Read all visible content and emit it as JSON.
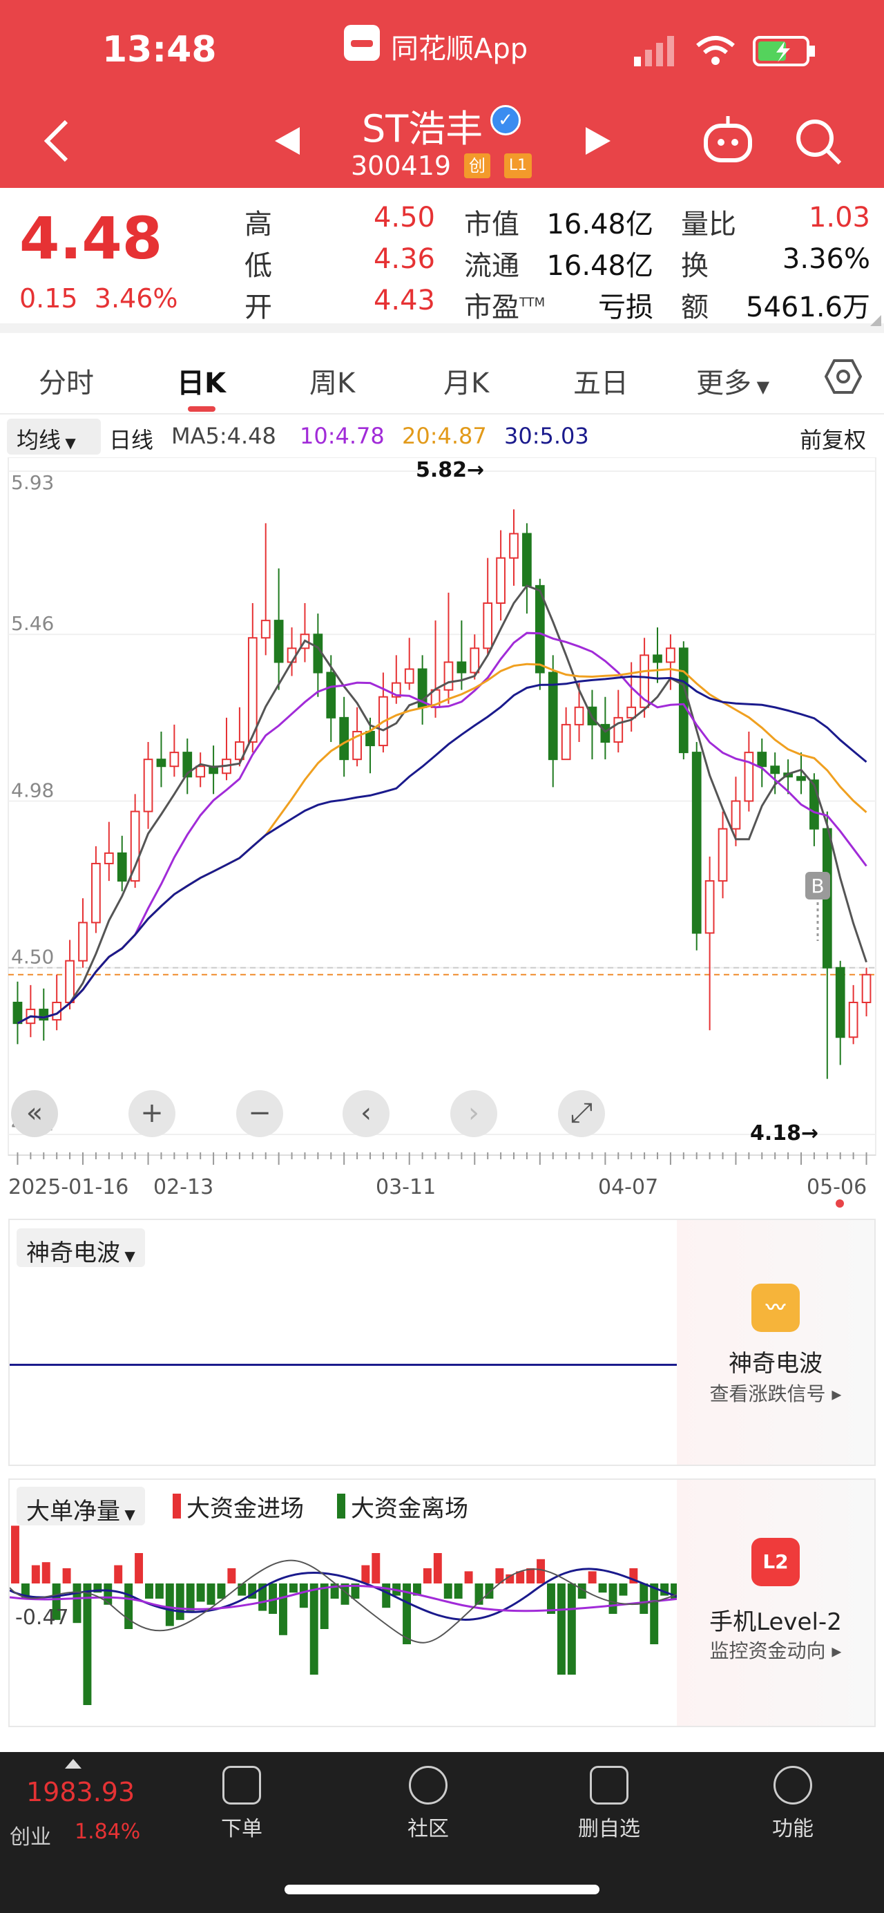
{
  "status_bar": {
    "time": "13:48",
    "app_name": "同花顺App"
  },
  "header": {
    "title": "ST浩丰",
    "code": "300419",
    "tag_chuang": "创",
    "tag_level": "L1"
  },
  "quote": {
    "price": "4.48",
    "change": "0.15",
    "change_pct": "3.46%",
    "fields": [
      {
        "label": "高",
        "value": "4.50",
        "color": "red"
      },
      {
        "label": "低",
        "value": "4.36",
        "color": "red"
      },
      {
        "label": "开",
        "value": "4.43",
        "color": "red"
      },
      {
        "label": "市值",
        "value": "16.48亿",
        "color": "black"
      },
      {
        "label": "流通",
        "value": "16.48亿",
        "color": "black"
      },
      {
        "label": "市盈",
        "value": "亏损",
        "color": "black",
        "sup": "TTM"
      },
      {
        "label": "量比",
        "value": "1.03",
        "color": "red"
      },
      {
        "label": "换",
        "value": "3.36%",
        "color": "black"
      },
      {
        "label": "额",
        "value": "5461.6万",
        "color": "black"
      }
    ]
  },
  "tabs": [
    "分时",
    "日K",
    "周K",
    "月K",
    "五日",
    "更多"
  ],
  "ma_bar": {
    "selector": "均线",
    "period": "日线",
    "ma5": "MA5:4.48",
    "ma10": "10:4.78",
    "ma20": "20:4.87",
    "ma30": "30:5.03",
    "adjust": "前复权"
  },
  "chart": {
    "y_ticks": [
      "5.93",
      "5.46",
      "4.98",
      "4.50",
      "4.02"
    ],
    "x_ticks": [
      "2025-01-16",
      "02-13",
      "03-11",
      "04-07",
      "05-06"
    ],
    "max_label": "5.82→",
    "min_label": "4.18→",
    "signal": "B"
  },
  "colors": {
    "up": "#e63234",
    "down": "#1f7a1f",
    "ma5": "#555555",
    "ma10": "#a12bd8",
    "ma20": "#f0a020",
    "ma30": "#1a1a8c",
    "header": "#e84448"
  },
  "panel1": {
    "tag": "神奇电波",
    "title": "神奇电波",
    "sub": "查看涨跌信号 ▸"
  },
  "panel2": {
    "tag": "大单净量",
    "legend_in": "大资金进场",
    "legend_out": "大资金离场",
    "y_label": "-0.47",
    "title": "手机Level-2",
    "sub": "监控资金动向 ▸",
    "icon": "L2"
  },
  "bottom_nav": {
    "index_value": "1983.93",
    "index_name": "创业",
    "index_pct": "1.84%",
    "items": [
      "下单",
      "社区",
      "删自选",
      "功能"
    ]
  },
  "chart_data": {
    "type": "candlestick",
    "ylim": [
      4.02,
      5.93
    ],
    "candles": [
      [
        4.4,
        4.34,
        4.46,
        4.28
      ],
      [
        4.34,
        4.38,
        4.45,
        4.3
      ],
      [
        4.38,
        4.35,
        4.44,
        4.29
      ],
      [
        4.35,
        4.4,
        4.48,
        4.32
      ],
      [
        4.4,
        4.52,
        4.58,
        4.38
      ],
      [
        4.52,
        4.63,
        4.7,
        4.5
      ],
      [
        4.63,
        4.8,
        4.85,
        4.6
      ],
      [
        4.8,
        4.83,
        4.92,
        4.75
      ],
      [
        4.83,
        4.75,
        4.88,
        4.72
      ],
      [
        4.75,
        4.95,
        5.0,
        4.73
      ],
      [
        4.95,
        5.1,
        5.15,
        4.9
      ],
      [
        5.1,
        5.08,
        5.18,
        5.02
      ],
      [
        5.08,
        5.12,
        5.2,
        5.05
      ],
      [
        5.12,
        5.05,
        5.16,
        5.0
      ],
      [
        5.05,
        5.08,
        5.12,
        5.02
      ],
      [
        5.08,
        5.06,
        5.14,
        5.0
      ],
      [
        5.06,
        5.1,
        5.22,
        5.04
      ],
      [
        5.1,
        5.15,
        5.25,
        5.08
      ],
      [
        5.15,
        5.45,
        5.55,
        5.12
      ],
      [
        5.45,
        5.5,
        5.78,
        5.4
      ],
      [
        5.5,
        5.38,
        5.65,
        5.3
      ],
      [
        5.38,
        5.42,
        5.48,
        5.34
      ],
      [
        5.42,
        5.46,
        5.55,
        5.38
      ],
      [
        5.46,
        5.35,
        5.52,
        5.28
      ],
      [
        5.35,
        5.22,
        5.4,
        5.15
      ],
      [
        5.22,
        5.1,
        5.28,
        5.05
      ],
      [
        5.1,
        5.18,
        5.25,
        5.08
      ],
      [
        5.18,
        5.14,
        5.22,
        5.06
      ],
      [
        5.14,
        5.28,
        5.35,
        5.12
      ],
      [
        5.28,
        5.32,
        5.4,
        5.26
      ],
      [
        5.32,
        5.36,
        5.45,
        5.3
      ],
      [
        5.36,
        5.25,
        5.4,
        5.2
      ],
      [
        5.25,
        5.3,
        5.5,
        5.22
      ],
      [
        5.3,
        5.38,
        5.58,
        5.26
      ],
      [
        5.38,
        5.35,
        5.5,
        5.3
      ],
      [
        5.35,
        5.42,
        5.46,
        5.33
      ],
      [
        5.42,
        5.55,
        5.68,
        5.4
      ],
      [
        5.55,
        5.68,
        5.76,
        5.5
      ],
      [
        5.68,
        5.75,
        5.82,
        5.6
      ],
      [
        5.75,
        5.6,
        5.78,
        5.52
      ],
      [
        5.6,
        5.35,
        5.62,
        5.3
      ],
      [
        5.35,
        5.1,
        5.4,
        5.02
      ],
      [
        5.1,
        5.2,
        5.25,
        5.12
      ],
      [
        5.2,
        5.25,
        5.32,
        5.15
      ],
      [
        5.25,
        5.2,
        5.3,
        5.1
      ],
      [
        5.2,
        5.15,
        5.28,
        5.1
      ],
      [
        5.15,
        5.22,
        5.3,
        5.12
      ],
      [
        5.22,
        5.25,
        5.38,
        5.18
      ],
      [
        5.25,
        5.4,
        5.45,
        5.22
      ],
      [
        5.4,
        5.38,
        5.48,
        5.32
      ],
      [
        5.38,
        5.42,
        5.46,
        5.3
      ],
      [
        5.42,
        5.12,
        5.44,
        5.1
      ],
      [
        5.12,
        4.6,
        5.15,
        4.55
      ],
      [
        4.6,
        4.75,
        4.82,
        4.32
      ],
      [
        4.75,
        4.9,
        4.95,
        4.7
      ],
      [
        4.9,
        4.98,
        5.05,
        4.85
      ],
      [
        4.98,
        5.12,
        5.18,
        4.95
      ],
      [
        5.12,
        5.08,
        5.16,
        5.02
      ],
      [
        5.08,
        5.06,
        5.12,
        5.0
      ],
      [
        5.06,
        5.05,
        5.1,
        5.0
      ],
      [
        5.05,
        5.04,
        5.12,
        5.0
      ],
      [
        5.04,
        4.9,
        5.06,
        4.85
      ],
      [
        4.9,
        4.5,
        4.95,
        4.18
      ],
      [
        4.5,
        4.3,
        4.52,
        4.22
      ],
      [
        4.3,
        4.4,
        4.45,
        4.28
      ],
      [
        4.4,
        4.48,
        4.5,
        4.36
      ]
    ]
  }
}
